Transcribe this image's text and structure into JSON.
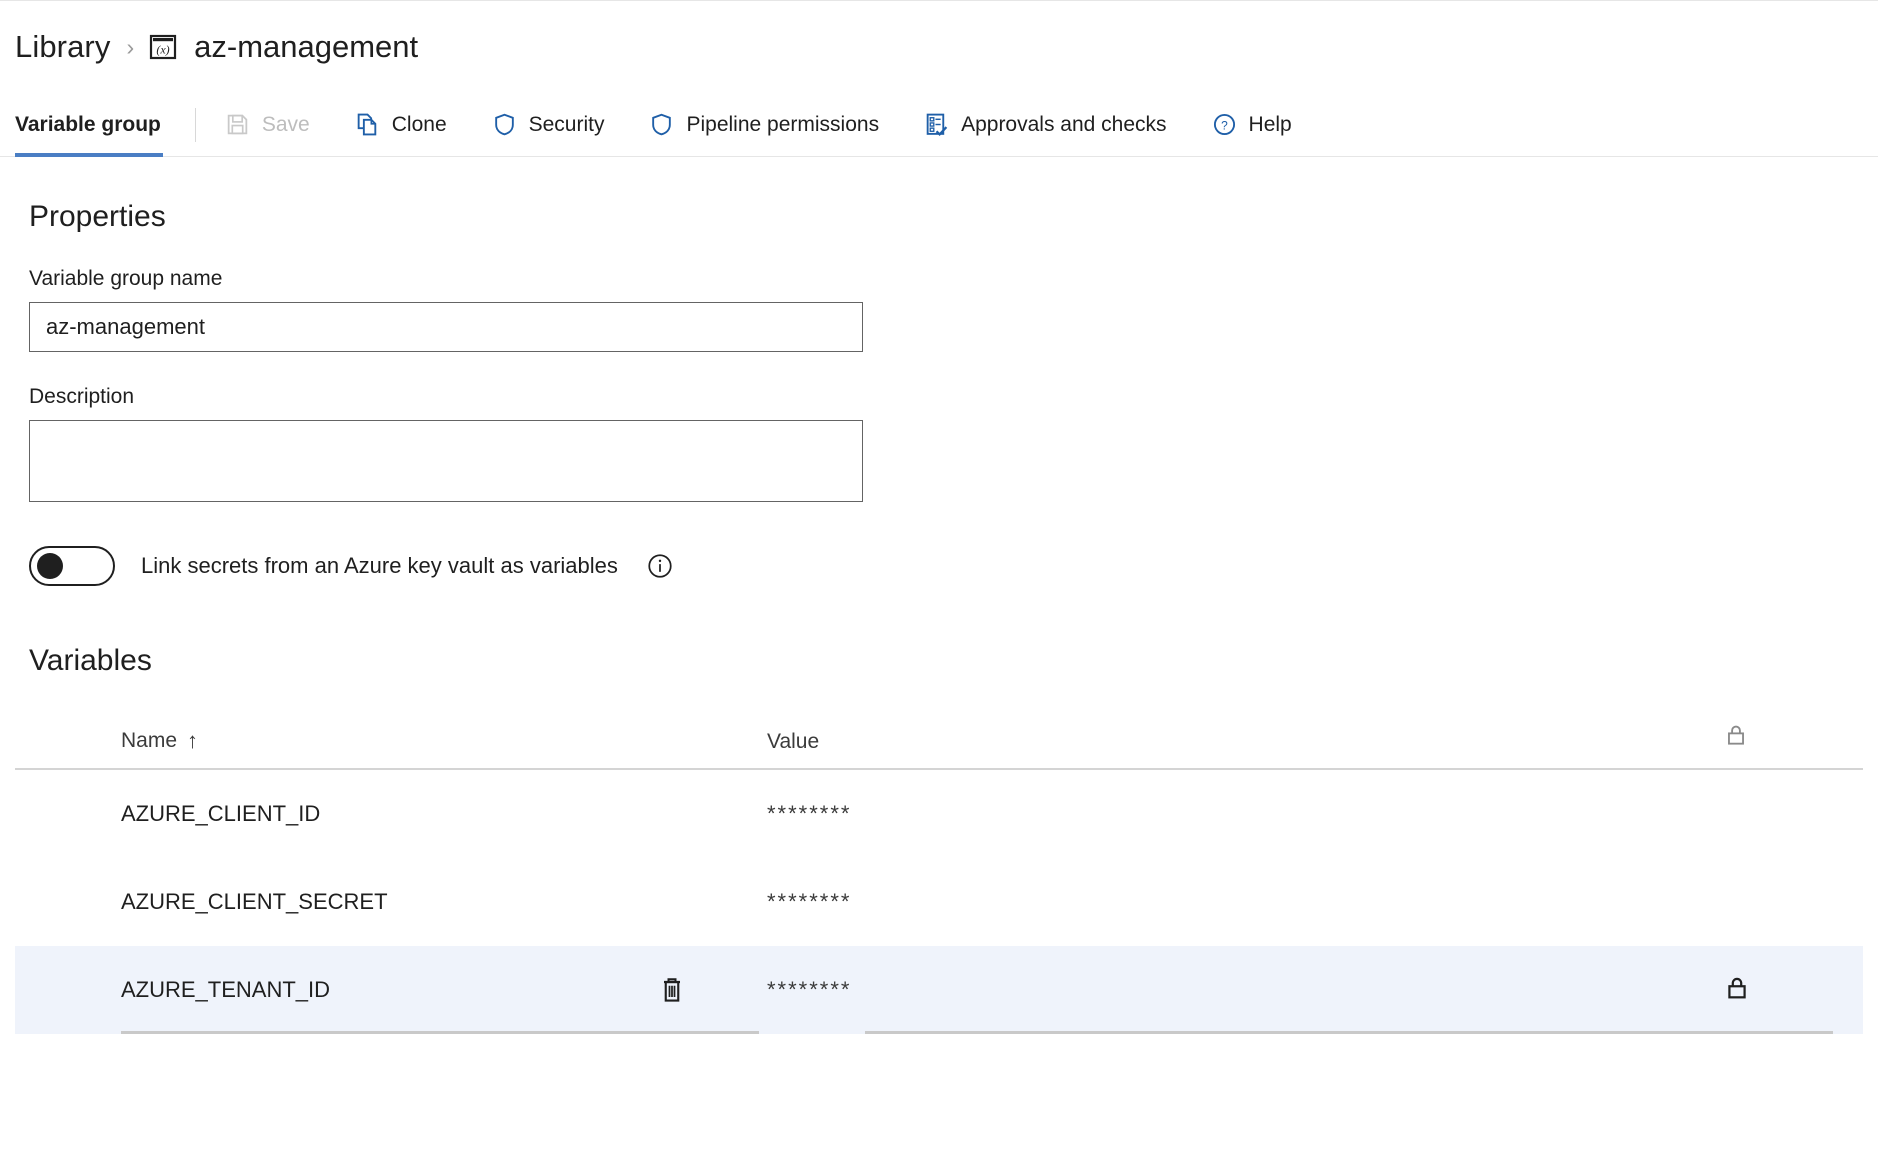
{
  "breadcrumb": {
    "root_label": "Library",
    "separator": "›",
    "icon_name": "variable-group-icon",
    "current_label": "az-management"
  },
  "toolbar": {
    "tab_label": "Variable group",
    "buttons": [
      {
        "label": "Save",
        "icon": "save-icon",
        "disabled": true
      },
      {
        "label": "Clone",
        "icon": "clone-icon",
        "disabled": false
      },
      {
        "label": "Security",
        "icon": "shield-icon",
        "disabled": false
      },
      {
        "label": "Pipeline permissions",
        "icon": "shield-icon",
        "disabled": false
      },
      {
        "label": "Approvals and checks",
        "icon": "checklist-icon",
        "disabled": false
      },
      {
        "label": "Help",
        "icon": "help-circle-icon",
        "disabled": false
      }
    ]
  },
  "properties": {
    "heading": "Properties",
    "name_label": "Variable group name",
    "name_value": "az-management",
    "name_placeholder": "",
    "description_label": "Description",
    "description_value": "",
    "description_placeholder": "",
    "keyvault_toggle_label": "Link secrets from an Azure key vault as variables",
    "keyvault_toggle_state": "off",
    "info_icon": "info-icon"
  },
  "variables": {
    "heading": "Variables",
    "columns": {
      "name": "Name",
      "sort_indicator": "↑",
      "value": "Value",
      "lock": "lock-icon"
    },
    "rows": [
      {
        "name": "AZURE_CLIENT_ID",
        "value": "********",
        "locked": false,
        "highlighted": false
      },
      {
        "name": "AZURE_CLIENT_SECRET",
        "value": "********",
        "locked": false,
        "highlighted": false
      },
      {
        "name": "AZURE_TENANT_ID",
        "value": "********",
        "locked": true,
        "highlighted": true
      }
    ]
  },
  "colors": {
    "accent": "#4a7ec4",
    "icon_blue": "#1f5fa8",
    "row_highlight": "#eff3fb",
    "text": "#1f1f1f",
    "disabled_text": "#bdbdbd"
  }
}
